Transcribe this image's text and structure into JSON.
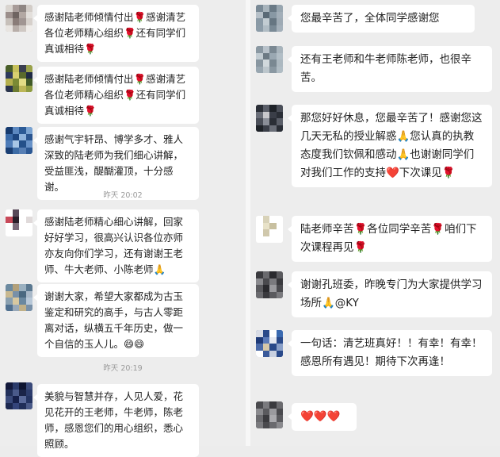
{
  "left_panel": {
    "messages": [
      {
        "text": "感谢陆老师倾情付出🌹感谢清艺各位老师精心组织🌹还有同学们真诚相待🌹"
      },
      {
        "text": "感谢陆老师倾情付出🌹感谢清艺各位老师精心组织🌹还有同学们真诚相待🌹"
      },
      {
        "text": "感谢气宇轩昂、博学多才、雅人深致的陆老师为我们细心讲解，受益匪浅，醍醐灌顶，十分感谢。"
      },
      {
        "text": "感谢陆老师精心细心讲解，回家好好学习，很高兴认识各位亦师亦友向你们学习，还有谢谢王老师、牛大老师、小陈老师🙏"
      },
      {
        "text": "谢谢大家，希望大家都成为古玉鉴定和研究的高手，与古人零距离对话，纵横五千年历史，做一个自信的玉人儿。😄😄"
      },
      {
        "text": "美貌与智慧并存，人见人爱，花见花开的王老师，牛老师，陈老师，感恩您们的用心组织，悉心照顾。"
      }
    ],
    "timestamps": [
      "昨天 20:02",
      "昨天 20:19"
    ]
  },
  "right_panel": {
    "messages": [
      {
        "text": "您最辛苦了，全体同学感谢您"
      },
      {
        "text": "还有王老师和牛老师陈老师，也很辛苦。"
      },
      {
        "text": "那您好好休息，您最辛苦了！感谢您这几天无私的授业解惑🙏您认真的执教态度我们钦佩和感动🙏也谢谢同学们对我们工作的支持❤️下次课见🌹"
      },
      {
        "text": "陆老师辛苦🌹各位同学辛苦🌹咱们下次课程再见🌹"
      },
      {
        "text": "谢谢孔班委，昨晚专门为大家提供学习场所🙏@KY"
      },
      {
        "text": "一句话：清艺班真好！！有幸！有幸！感恩所有遇见！期待下次再逢！"
      },
      {
        "text": "❤️❤️❤️"
      }
    ]
  },
  "colors": {
    "background": "#ededed",
    "bubble": "#ffffff",
    "text": "#222222",
    "timestamp": "#9a9a9a"
  }
}
